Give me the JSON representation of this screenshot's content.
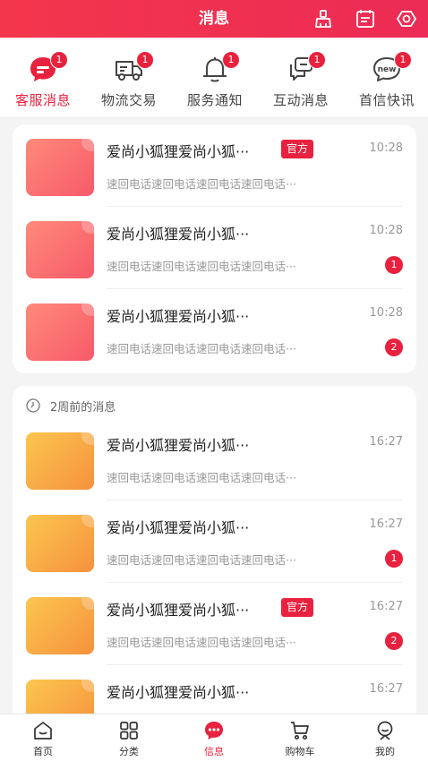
{
  "header": {
    "title": "消息",
    "icons": [
      "clean-icon",
      "list-icon",
      "eye-settings-icon"
    ]
  },
  "tabs": [
    {
      "label": "客服消息",
      "badge": "1",
      "icon": "customer-service-icon",
      "active": true
    },
    {
      "label": "物流交易",
      "badge": "1",
      "icon": "truck-icon",
      "active": false
    },
    {
      "label": "服务通知",
      "badge": "1",
      "icon": "bell-icon",
      "active": false
    },
    {
      "label": "互动消息",
      "badge": "1",
      "icon": "chat-icon",
      "active": false
    },
    {
      "label": "首信快讯",
      "badge": "1",
      "icon": "new-icon",
      "active": false
    }
  ],
  "recent": {
    "items": [
      {
        "name": "爱尚小狐狸爱尚小狐···",
        "tag": "官方",
        "time": "10:28",
        "preview": "速回电话速回电话速回电话速回电话···",
        "badge": ""
      },
      {
        "name": "爱尚小狐狸爱尚小狐···",
        "tag": "",
        "time": "10:28",
        "preview": "速回电话速回电话速回电话速回电话···",
        "badge": "1"
      },
      {
        "name": "爱尚小狐狸爱尚小狐···",
        "tag": "",
        "time": "10:28",
        "preview": "速回电话速回电话速回电话速回电话···",
        "badge": "2"
      }
    ]
  },
  "older": {
    "section_label": "2周前的消息",
    "items": [
      {
        "name": "爱尚小狐狸爱尚小狐···",
        "tag": "",
        "time": "16:27",
        "preview": "速回电话速回电话速回电话速回电话···",
        "badge": ""
      },
      {
        "name": "爱尚小狐狸爱尚小狐···",
        "tag": "",
        "time": "16:27",
        "preview": "速回电话速回电话速回电话速回电话···",
        "badge": "1"
      },
      {
        "name": "爱尚小狐狸爱尚小狐···",
        "tag": "官方",
        "time": "16:27",
        "preview": "速回电话速回电话速回电话速回电话···",
        "badge": "2"
      },
      {
        "name": "爱尚小狐狸爱尚小狐···",
        "tag": "",
        "time": "16:27",
        "preview": "",
        "badge": ""
      }
    ]
  },
  "bottom_nav": [
    {
      "label": "首页",
      "icon": "home-icon",
      "active": false
    },
    {
      "label": "分类",
      "icon": "category-icon",
      "active": false
    },
    {
      "label": "信息",
      "icon": "message-icon",
      "active": true
    },
    {
      "label": "购物车",
      "icon": "cart-icon",
      "active": false
    },
    {
      "label": "我的",
      "icon": "profile-icon",
      "active": false
    }
  ],
  "colors": {
    "accent": "#e8223e",
    "header_start": "#f4364c",
    "header_end": "#ec2b55"
  }
}
